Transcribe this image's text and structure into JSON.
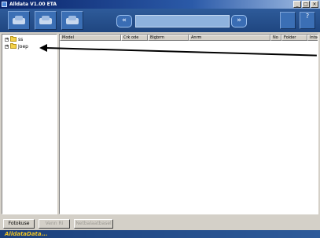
{
  "window": {
    "title": "Alldata V1.00 ETA",
    "buttons": [
      "_",
      "□",
      "×"
    ]
  },
  "toolbar": {
    "icons": [
      "document-car-icon",
      "car-icon",
      "vehicle-icon"
    ],
    "back_label": "«",
    "forward_label": "»",
    "right_icons": [
      "window-icon",
      "help-icon"
    ],
    "help_label": "?"
  },
  "tree": {
    "nodes": [
      {
        "expander": "+",
        "label": "ss"
      },
      {
        "expander": "+",
        "label": "Joep"
      }
    ]
  },
  "list": {
    "columns": [
      "Model",
      "Crk ode",
      "Bigbrm",
      "Anrm",
      "No",
      "Folder",
      "Intsorce"
    ]
  },
  "bottom_buttons": {
    "button1": "Fotokuse",
    "button2": "Venn Ri",
    "button3": "Netbalaatbasel"
  },
  "brand": {
    "logo_text": "AlldataData..."
  },
  "colors": {
    "toolbar_blue": "#1f4680",
    "window_gray": "#d4d0c8",
    "brand_yellow": "#f3c623"
  }
}
